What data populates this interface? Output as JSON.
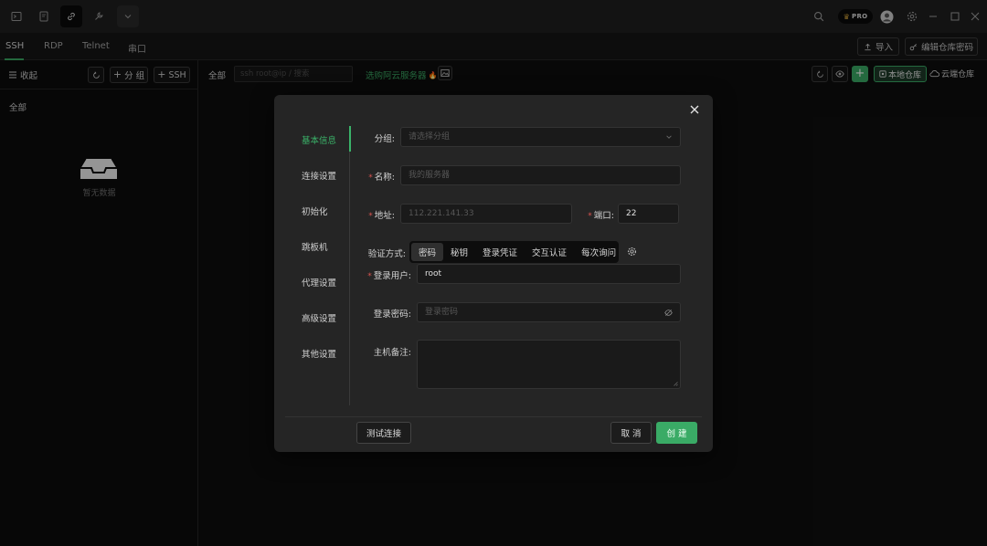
{
  "titlebar": {
    "tabs": [
      "terminal-icon",
      "document-icon",
      "link-icon",
      "wrench-icon"
    ],
    "dropdown_icon": "chevron-down-icon",
    "pro_label": "PRO"
  },
  "protocols": {
    "tabs": [
      "SSH",
      "RDP",
      "Telnet",
      "串口"
    ],
    "import_label": "导入",
    "edit_vault_label": "编辑仓库密码"
  },
  "sidebar": {
    "collapse_label": "收起",
    "add_group_label": "分 组",
    "add_ssh_label": "SSH",
    "group_all": "全部",
    "empty_text": "暂无数据"
  },
  "main": {
    "filter_all": "全部",
    "search_placeholder": "ssh root@ip / 搜索",
    "promo_link": "选购阿云服务器",
    "local_vault_label": "本地仓库",
    "cloud_vault_label": "云端仓库"
  },
  "modal": {
    "nav": [
      "基本信息",
      "连接设置",
      "初始化",
      "跳板机",
      "代理设置",
      "高级设置",
      "其他设置"
    ],
    "fields": {
      "group_label": "分组:",
      "group_placeholder": "请选择分组",
      "name_label": "名称:",
      "name_placeholder": "我的服务器",
      "host_label": "地址:",
      "host_placeholder": "112.221.141.33",
      "port_label": "端口:",
      "port_value": "22",
      "auth_label": "验证方式:",
      "auth_options": [
        "密码",
        "秘钥",
        "登录凭证",
        "交互认证",
        "每次询问"
      ],
      "auth_selected": "密码",
      "user_label": "登录用户:",
      "user_value": "root",
      "password_label": "登录密码:",
      "password_placeholder": "登录密码",
      "note_label": "主机备注:"
    },
    "buttons": {
      "test_label": "测试连接",
      "cancel_label": "取 消",
      "create_label": "创 建"
    }
  },
  "colors": {
    "accent": "#3aab66",
    "required": "#d9534f",
    "promo": "#3aa863"
  }
}
